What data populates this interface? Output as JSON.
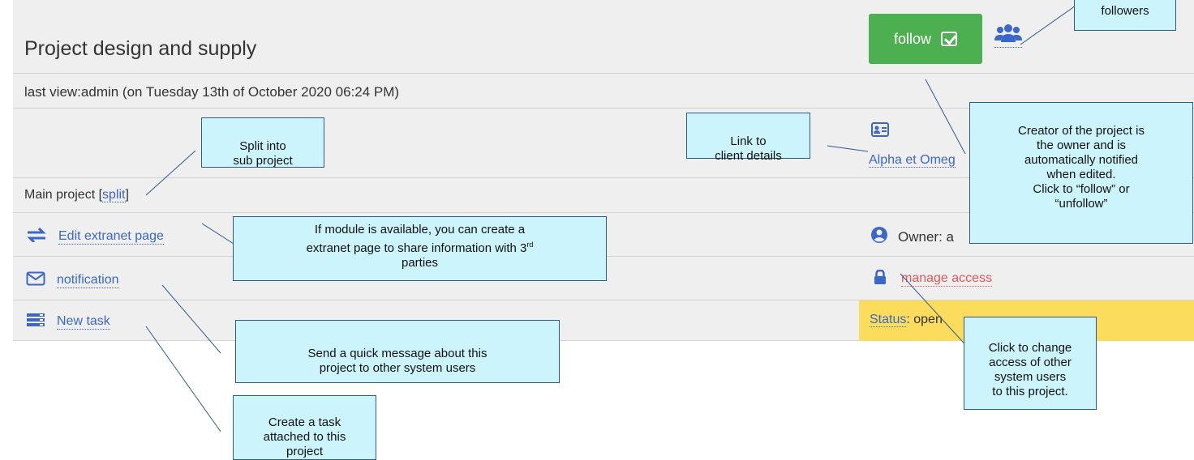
{
  "header": {
    "title": "Project design and supply",
    "follow_label": "follow",
    "last_view": "last view:admin (on Tuesday 13th of October 2020 06:24 PM)"
  },
  "client": {
    "link_label": "Alpha et Omeg"
  },
  "project": {
    "main_prefix": "Main project [",
    "split_label": "split",
    "main_suffix": "]"
  },
  "actions": [
    {
      "label": "Edit extranet page",
      "icon": "arrows-exchange-icon"
    },
    {
      "label": "notification",
      "icon": "envelope-icon"
    },
    {
      "label": "New task",
      "icon": "tasks-icon"
    }
  ],
  "right": {
    "owner_label": "Owner: a",
    "manage_access_label": "manage access",
    "status_label": "Status",
    "status_value": ": open"
  },
  "annotations": {
    "followers": "followers",
    "split": "Split into\nsub project",
    "client": "Link to\nclient details",
    "creator": "Creator of the project is\nthe owner and is\nautomatically notified\nwhen edited.\nClick to “follow” or\n“unfollow”",
    "extranet_1": "If module is available, you can create a",
    "extranet_2": "extranet page to share information with 3",
    "extranet_sup": "rd",
    "extranet_3": "parties",
    "notification": "Send a quick message about this\nproject to other system users",
    "task": "Create a task\nattached to this\nproject",
    "access": "Click to change\naccess of other\nsystem users\nto this project."
  },
  "colors": {
    "follow_button": "#4caf50",
    "link": "#3a67c9",
    "manage_access": "#e05a5a",
    "status_background": "#fcdc5c",
    "annotation_background": "#ccf4fc"
  }
}
